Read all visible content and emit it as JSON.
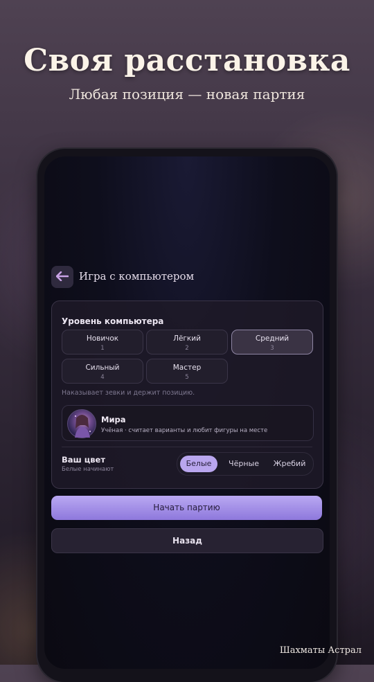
{
  "header": {
    "title": "Своя расстановка",
    "subtitle": "Любая позиция — новая партия"
  },
  "screen": {
    "title": "Игра с компьютером",
    "back_icon": "arrow-left-icon"
  },
  "level": {
    "heading": "Уровень компьютера",
    "options": [
      {
        "label": "Новичок",
        "value": "1"
      },
      {
        "label": "Лёгкий",
        "value": "2"
      },
      {
        "label": "Средний",
        "value": "3"
      },
      {
        "label": "Сильный",
        "value": "4"
      },
      {
        "label": "Мастер",
        "value": "5"
      }
    ],
    "selected": "Средний",
    "hint": "Наказывает зевки и держит позицию."
  },
  "opponent": {
    "name": "Мира",
    "description": "Учёная · считает варианты и любит фигуры на месте"
  },
  "color": {
    "label": "Ваш цвет",
    "sub": "Белые начинают",
    "options": [
      "Белые",
      "Чёрные",
      "Жребий"
    ],
    "selected": "Белые"
  },
  "actions": {
    "start": "Начать партию",
    "back": "Назад"
  },
  "footer": {
    "brand": "Шахматы Астрал"
  },
  "colors": {
    "accent": "#b9a6ee",
    "background": "#0e0e1c"
  }
}
